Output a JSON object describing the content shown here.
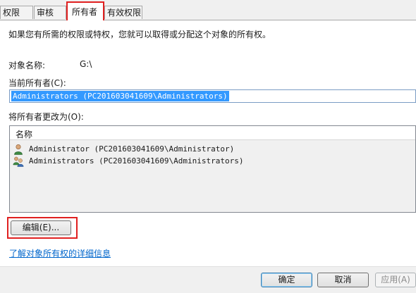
{
  "tabs": [
    {
      "label": "权限",
      "active": false
    },
    {
      "label": "审核",
      "active": false
    },
    {
      "label": "所有者",
      "active": true
    },
    {
      "label": "有效权限",
      "active": false
    }
  ],
  "owner_page": {
    "intro": "如果您有所需的权限或特权，您就可以取得或分配这个对象的所有权。",
    "object_name_label": "对象名称:",
    "object_name_value": "G:\\",
    "current_owner_label": "当前所有者(C):",
    "current_owner_value": "Administrators (PC201603041609\\Administrators)",
    "change_owner_label": "将所有者更改为(O):",
    "list_header": "名称",
    "owners": [
      {
        "name": "Administrator (PC201603041609\\Administrator)",
        "icon": "user-icon"
      },
      {
        "name": "Administrators (PC201603041609\\Administrators)",
        "icon": "group-icon"
      }
    ],
    "edit_button": "编辑(E)...",
    "learn_more_link": "了解对象所有权的详细信息"
  },
  "footer": {
    "ok": "确定",
    "cancel": "取消",
    "apply": "应用(A)"
  },
  "colors": {
    "highlight": "#e02020",
    "selection": "#3399ff",
    "link": "#0066cc"
  }
}
